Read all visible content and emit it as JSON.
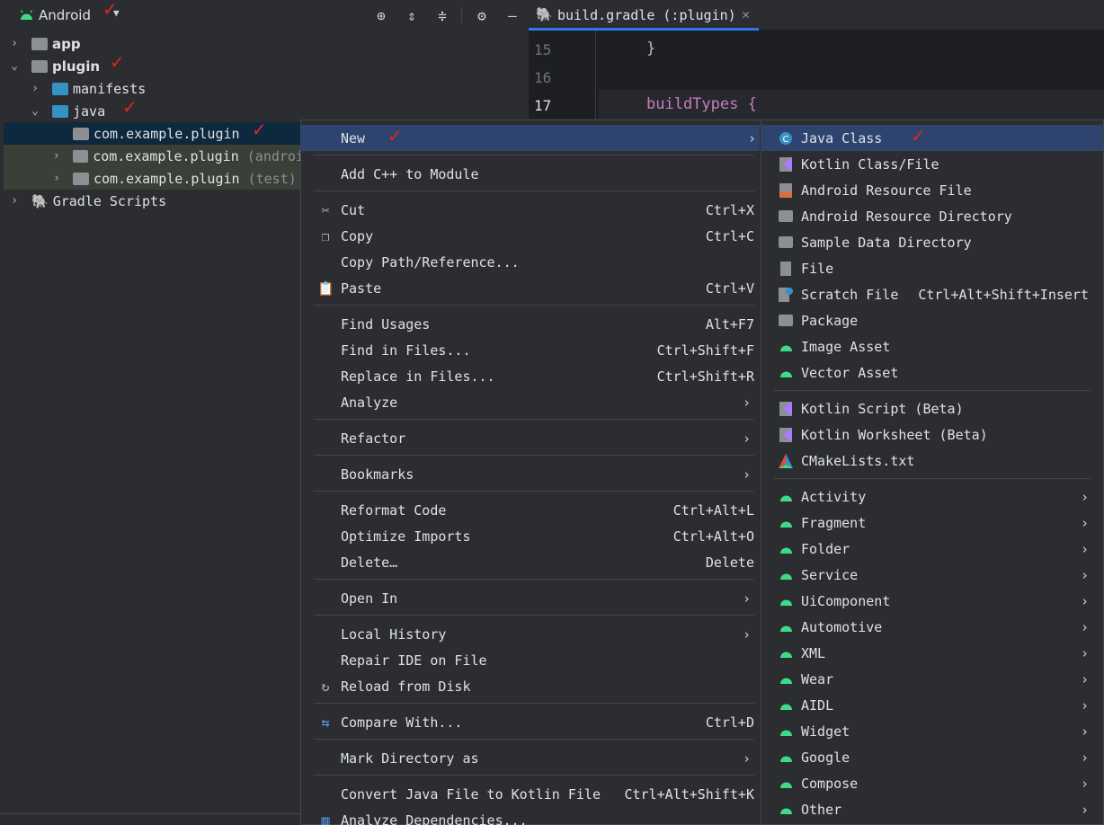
{
  "toolbar": {
    "view_label": "Android"
  },
  "tree": {
    "app": "app",
    "plugin": "plugin",
    "manifests": "manifests",
    "java": "java",
    "pkg1": "com.example.plugin",
    "pkg2": "com.example.plugin",
    "pkg2_suffix": "(androi",
    "pkg3": "com.example.plugin",
    "pkg3_suffix": "(test)",
    "gradle": "Gradle Scripts"
  },
  "editor": {
    "tab_label": "build.gradle (:plugin)",
    "lines": [
      {
        "num": "15",
        "code": "}"
      },
      {
        "num": "16",
        "code": ""
      },
      {
        "num": "17",
        "code": "buildTypes {"
      }
    ]
  },
  "context_menu": {
    "new": "New",
    "add_cpp": "Add C++ to Module",
    "cut": "Cut",
    "cut_sc": "Ctrl+X",
    "copy": "Copy",
    "copy_sc": "Ctrl+C",
    "copy_path": "Copy Path/Reference...",
    "paste": "Paste",
    "paste_sc": "Ctrl+V",
    "find_usages": "Find Usages",
    "find_usages_sc": "Alt+F7",
    "find_files": "Find in Files...",
    "find_files_sc": "Ctrl+Shift+F",
    "replace_files": "Replace in Files...",
    "replace_files_sc": "Ctrl+Shift+R",
    "analyze": "Analyze",
    "refactor": "Refactor",
    "bookmarks": "Bookmarks",
    "reformat": "Reformat Code",
    "reformat_sc": "Ctrl+Alt+L",
    "optimize": "Optimize Imports",
    "optimize_sc": "Ctrl+Alt+O",
    "delete": "Delete…",
    "delete_sc": "Delete",
    "open_in": "Open In",
    "local_history": "Local History",
    "repair": "Repair IDE on File",
    "reload": "Reload from Disk",
    "compare": "Compare With...",
    "compare_sc": "Ctrl+D",
    "mark_dir": "Mark Directory as",
    "convert": "Convert Java File to Kotlin File",
    "convert_sc": "Ctrl+Alt+Shift+K",
    "analyze_deps": "Analyze Dependencies..."
  },
  "sub_menu": {
    "java_class": "Java Class",
    "kotlin_class": "Kotlin Class/File",
    "android_res_file": "Android Resource File",
    "android_res_dir": "Android Resource Directory",
    "sample_data": "Sample Data Directory",
    "file": "File",
    "scratch": "Scratch File",
    "scratch_sc": "Ctrl+Alt+Shift+Insert",
    "package": "Package",
    "image_asset": "Image Asset",
    "vector_asset": "Vector Asset",
    "kotlin_script": "Kotlin Script (Beta)",
    "kotlin_worksheet": "Kotlin Worksheet (Beta)",
    "cmake": "CMakeLists.txt",
    "groups": [
      "Activity",
      "Fragment",
      "Folder",
      "Service",
      "UiComponent",
      "Automotive",
      "XML",
      "Wear",
      "AIDL",
      "Widget",
      "Google",
      "Compose",
      "Other"
    ]
  },
  "colors": {
    "accent": "#2e436e",
    "android_green": "#3ddc84",
    "folder_blue": "#3592c4"
  }
}
